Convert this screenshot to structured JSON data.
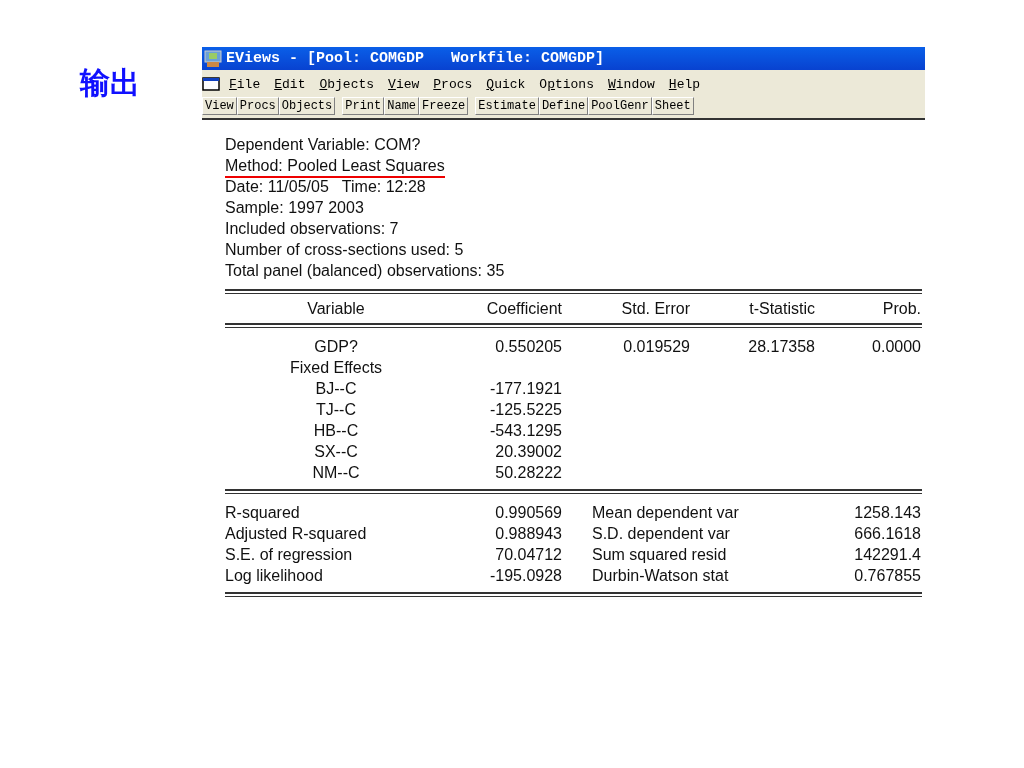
{
  "slide_label": "输出",
  "window": {
    "title": "EViews - [Pool: COMGDP   Workfile: COMGDP]",
    "menu": [
      {
        "mnemonic": "F",
        "rest": "ile"
      },
      {
        "mnemonic": "E",
        "rest": "dit"
      },
      {
        "mnemonic": "O",
        "rest": "bjects"
      },
      {
        "mnemonic": "V",
        "rest": "iew"
      },
      {
        "mnemonic": "P",
        "rest": "rocs"
      },
      {
        "mnemonic": "Q",
        "rest": "uick"
      },
      {
        "lead": "O",
        "mnemonic": "p",
        "rest": "tions"
      },
      {
        "mnemonic": "W",
        "rest": "indow"
      },
      {
        "mnemonic": "H",
        "rest": "elp"
      }
    ],
    "toolbar": [
      [
        "View",
        "Procs",
        "Objects"
      ],
      [
        "Print",
        "Name",
        "Freeze"
      ],
      [
        "Estimate",
        "Define",
        "PoolGenr",
        "Sheet"
      ]
    ]
  },
  "output": {
    "header_lines": [
      {
        "text": "Dependent Variable: COM?",
        "underlined": false
      },
      {
        "text": "Method: Pooled Least Squares",
        "underlined": true
      },
      {
        "text": "Date: 11/05/05   Time: 12:28",
        "underlined": false
      },
      {
        "text": "Sample: 1997 2003",
        "underlined": false
      },
      {
        "text": "Included observations: 7",
        "underlined": false
      },
      {
        "text": "Number of cross-sections used: 5",
        "underlined": false
      },
      {
        "text": "Total panel (balanced) observations: 35",
        "underlined": false
      }
    ],
    "columns": [
      "Variable",
      "Coefficient",
      "Std. Error",
      "t-Statistic",
      "Prob."
    ],
    "rows": [
      [
        "GDP?",
        "0.550205",
        "0.019529",
        "28.17358",
        "0.0000"
      ],
      [
        "Fixed Effects"
      ],
      [
        "BJ--C",
        "-177.1921"
      ],
      [
        "TJ--C",
        "-125.5225"
      ],
      [
        "HB--C",
        "-543.1295"
      ],
      [
        "SX--C",
        "20.39002"
      ],
      [
        "NM--C",
        "50.28222"
      ]
    ],
    "stats": [
      [
        "R-squared",
        "0.990569",
        "Mean dependent var",
        "1258.143"
      ],
      [
        "Adjusted R-squared",
        "0.988943",
        "S.D. dependent var",
        "666.1618"
      ],
      [
        "S.E. of regression",
        "70.04712",
        "Sum squared resid",
        "142291.4"
      ],
      [
        "Log likelihood",
        "-195.0928",
        "Durbin-Watson stat",
        "0.767855"
      ]
    ]
  }
}
